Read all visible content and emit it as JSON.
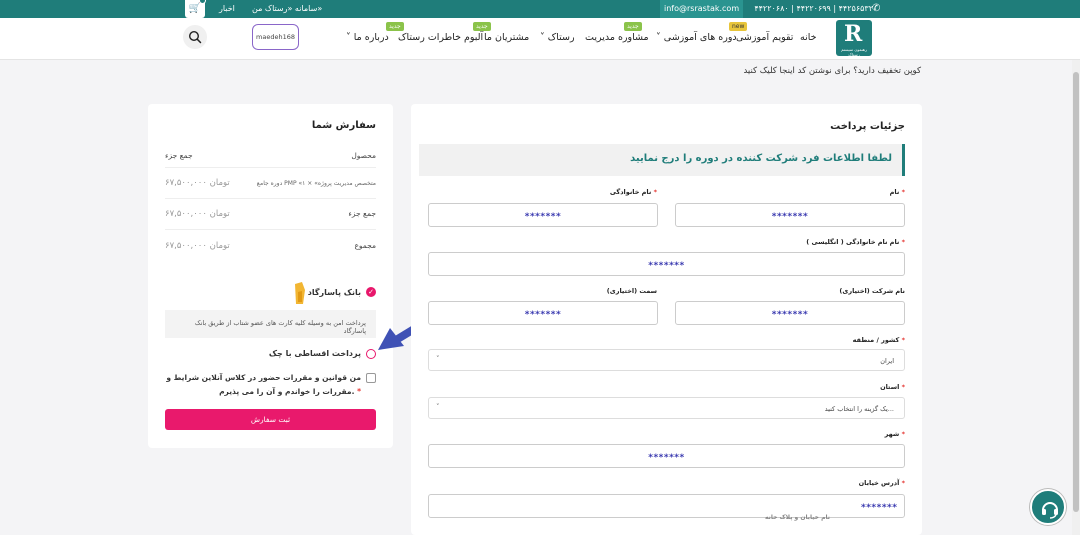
{
  "topbar": {
    "phone": "۴۴۲۲۰۶۸۰ | ۴۴۲۲۰۶۹۹ | ۴۴۲۵۶۵۳۲",
    "email": "info@rsrastak.com",
    "link_system": "سامانه «رستاک من»",
    "link_news": "اخبار"
  },
  "nav": {
    "logo_letter": "R",
    "logo_sub": "رهنمون سیستم رستاک",
    "items": [
      {
        "label": "خانه"
      },
      {
        "label": "تقویم آموزشی",
        "badge": "new"
      },
      {
        "label": "دوره های آموزشی"
      },
      {
        "label": "مشاوره مدیریت",
        "badge": "جدید"
      },
      {
        "label": "رستاک"
      },
      {
        "label": "مشتریان ما",
        "badge": "جدید"
      },
      {
        "label": "آلبوم خاطرات رستاک",
        "badge": "جدید"
      },
      {
        "label": "درباره ما"
      }
    ],
    "user": "maedeh168"
  },
  "coupon_text": "کوپن تخفیف دارید؟ برای نوشتن کد اینجا کلیک کنید",
  "order": {
    "title": "سفارش شما",
    "col_product": "محصول",
    "col_subtotal": "جمع جزء",
    "item_name": "دوره جامع PMP «متخصص مدیریت پروژه» × ۱",
    "item_price": "۶۷,۵۰۰,۰۰۰",
    "currency": "تومان",
    "subtotal_label": "جمع جزء",
    "subtotal_value": "۶۷,۵۰۰,۰۰۰",
    "total_label": "مجموع",
    "total_value": "۶۷,۵۰۰,۰۰۰",
    "bank_label": "بانک پاسارگاد",
    "bank_desc": "پرداخت امن به وسیله کلیه کارت های عضو شتاب از طریق بانک پاسارگاد",
    "cheque_label": "پرداخت اقساطی با چک",
    "terms_text": "من قوانین و مقررات حضور در کلاس آنلاین شرایط و مقررات را خواندم و آن را می پذیرم.",
    "submit": "ثبت سفارش"
  },
  "payment": {
    "title": "جزئیات پرداخت",
    "notice": "لطفا اطلاعات فرد شرکت کننده در دوره را درج نمایید",
    "first_name_label": "نام",
    "last_name_label": "نام خانوادگی",
    "eng_name_label": "نام نام خانوادگی ( انگلیسی )",
    "company_label": "نام شرکت (اختیاری)",
    "position_label": "سمت (اختیاری)",
    "country_label": "کشور / منطقه",
    "country_value": "ایران",
    "province_label": "استان",
    "province_value": "یک گزینه را انتخاب کنید...",
    "city_label": "شهر",
    "address_label": "آدرس خیابان",
    "address_placeholder": "نام خیابان و پلاک خانه",
    "masked": "*******"
  },
  "colors": {
    "brand": "#1f7d7a",
    "accent": "#e9196c",
    "arrow": "#3f51b5"
  }
}
